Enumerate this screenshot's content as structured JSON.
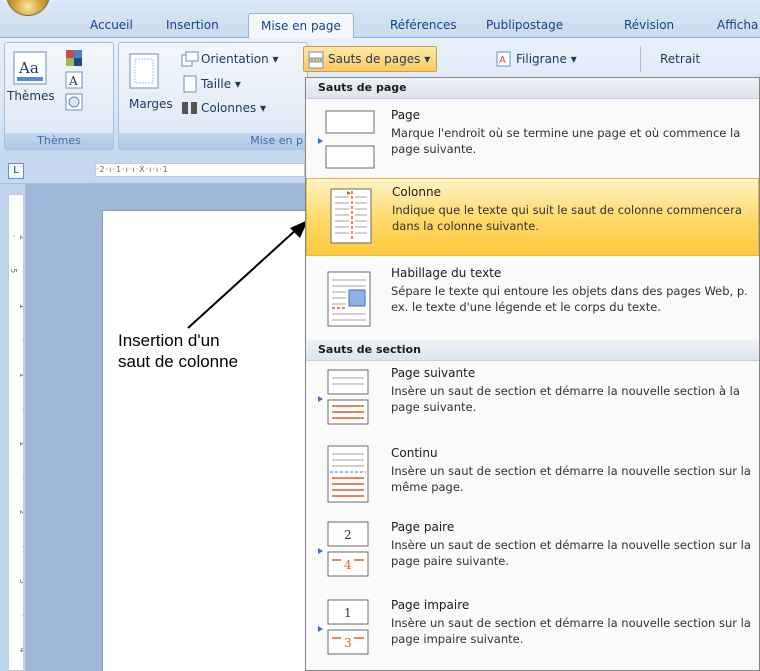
{
  "tabs": [
    {
      "label": "Accueil",
      "active": false
    },
    {
      "label": "Insertion",
      "active": false
    },
    {
      "label": "Mise en page",
      "active": true
    },
    {
      "label": "Références",
      "active": false
    },
    {
      "label": "Publipostage",
      "active": false
    },
    {
      "label": "Révision",
      "active": false
    },
    {
      "label": "Afficha",
      "active": false
    }
  ],
  "ribbon": {
    "themes_button": "Thèmes",
    "themes_group": "Thèmes",
    "marges": "Marges",
    "orientation": "Orientation ▾",
    "taille": "Taille ▾",
    "colonnes": "Colonnes ▾",
    "sauts_de_pages": "Sauts de pages ▾",
    "filigrane": "Filigrane ▾",
    "retrait": "Retrait",
    "page_setup_group": "Mise en p"
  },
  "ruler": {
    "corner": "L",
    "top_marks": "·2·ı·1·ı·ı·Ẋ·ı·ı·1",
    "left_marks": "2 · 1 · 1 · 1 · 2 · 3 · 4 · 5"
  },
  "annotation": {
    "line1": "Insertion d'un",
    "line2": "saut de colonne"
  },
  "menu": {
    "page_breaks_header": "Sauts de page",
    "section_breaks_header": "Sauts de section",
    "items": [
      {
        "title": "Page",
        "description": "Marque l'endroit où se termine une page et où commence la page suivante.",
        "highlighted": false
      },
      {
        "title": "Colonne",
        "description": "Indique que le texte qui suit le saut de colonne commencera dans la colonne suivante.",
        "highlighted": true
      },
      {
        "title": "Habillage du texte",
        "description": "Sépare le texte qui entoure les objets dans des pages Web, p. ex. le texte d'une légende et le corps du texte.",
        "highlighted": false
      },
      {
        "title": "Page suivante",
        "description": "Insère un saut de section et démarre la nouvelle section à la page suivante.",
        "highlighted": false
      },
      {
        "title": "Continu",
        "description": "Insère un saut de section et démarre la nouvelle section sur la même page.",
        "highlighted": false
      },
      {
        "title": "Page paire",
        "description": "Insère un saut de section et démarre la nouvelle section sur la page paire suivante.",
        "highlighted": false
      },
      {
        "title": "Page impaire",
        "description": "Insère un saut de section et démarre la nouvelle section sur la page impaire suivante.",
        "highlighted": false
      }
    ]
  },
  "colors": {
    "ribbon_text": "#15428b",
    "highlight": "#ffd966",
    "break_line": "#e05a2b"
  }
}
